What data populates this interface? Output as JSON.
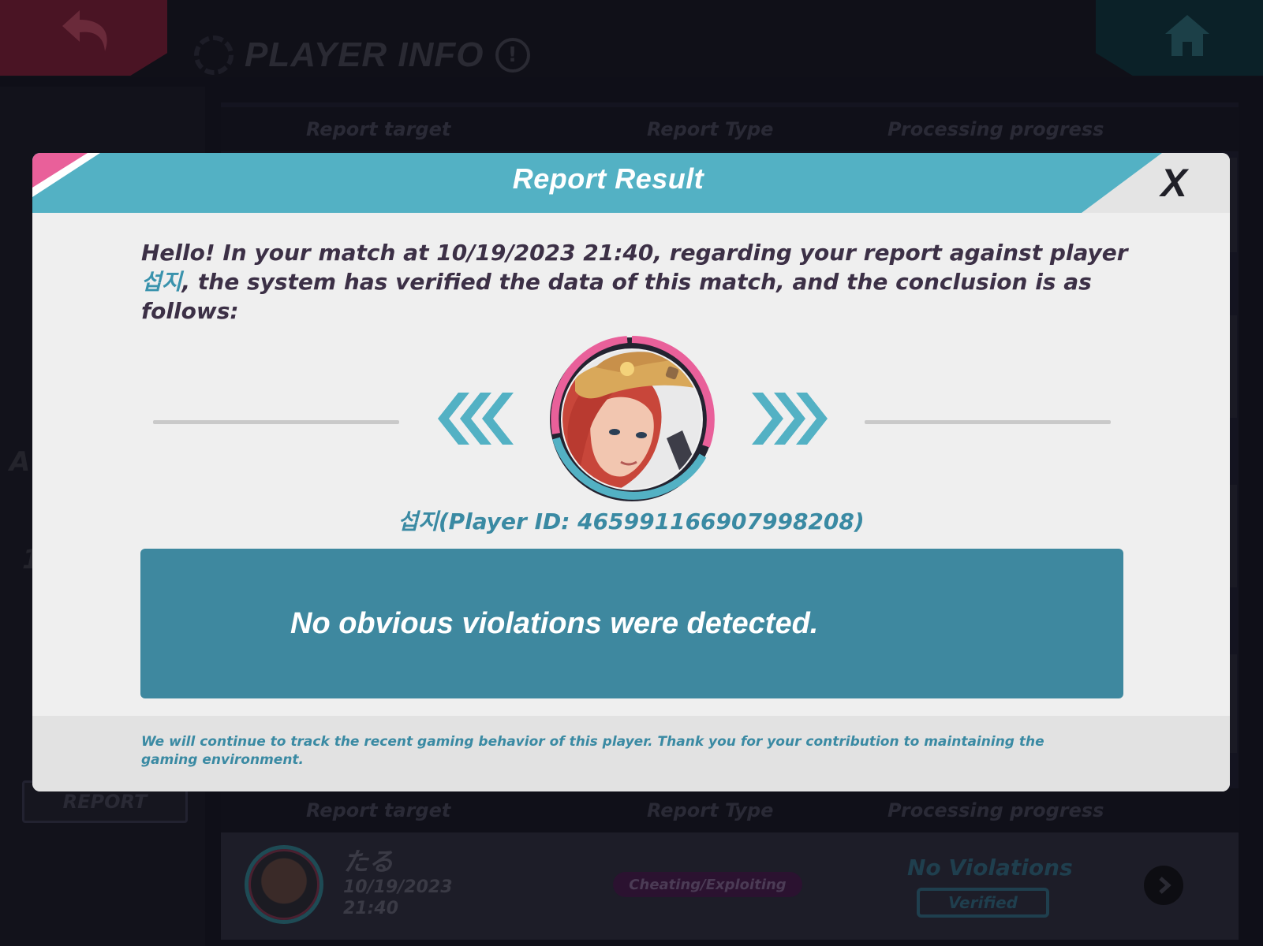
{
  "page": {
    "title": "PLAYER INFO",
    "info_icon": "!",
    "sidebar_a": "A",
    "sidebar_1": "1",
    "report_button": "REPORT"
  },
  "table": {
    "headers": [
      "Report target",
      "Report Type",
      "Processing progress"
    ],
    "row": {
      "name": "たる",
      "date": "10/19/2023 21:40",
      "type": "Cheating/Exploiting",
      "result": "No Violations",
      "status": "Verified"
    }
  },
  "modal": {
    "title": "Report Result",
    "close": "X",
    "message_prefix": "Hello! In your match at 10/19/2023 21:40, regarding your report against player ",
    "player_name": "섭지",
    "message_suffix": ", the system has verified the data of this match, and the conclusion is as follows:",
    "player_id_line": "섭지(Player ID: 465991166907998208)",
    "result": "No obvious violations were detected.",
    "footer": "We will continue to track the recent gaming behavior of this player. Thank you for your contribution to maintaining the gaming environment."
  },
  "colors": {
    "header_band": "#53b1c4",
    "accent_pink": "#e9609a",
    "result_box": "#3e889f",
    "text_dark": "#3c3046",
    "link_blue": "#3a8aa3"
  },
  "icons": [
    "back-arrow-icon",
    "home-icon",
    "info-icon",
    "close-icon",
    "chevron-left-double-icon",
    "chevron-right-double-icon",
    "chevron-right-icon"
  ]
}
